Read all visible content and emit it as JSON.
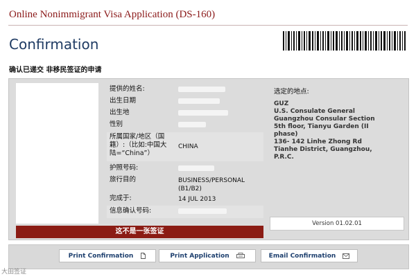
{
  "header": {
    "title": "Online Nonimmigrant Visa Application (DS-160)",
    "page_title": "Confirmation",
    "subtitle": "确认已递交  非移民签证的申请"
  },
  "applicant": {
    "surname_label": "提供的姓名:",
    "dob_label": "出生日期",
    "pob_label": "出生地",
    "gender_label": "性别",
    "nationality_label_line1": "所属国家/地区（国",
    "nationality_label_line2": "籍）:（比如:中国大",
    "nationality_label_line3": "陆=“China”）",
    "nationality_value": "CHINA",
    "passport_label": "护照号码:",
    "purpose_label": "旅行目的",
    "purpose_value_line1": "BUSINESS/PERSONAL",
    "purpose_value_line2": "(B1/B2)",
    "completed_label": "完成于:",
    "completed_value": "14 JUL 2013",
    "confirmation_label": "信息确认号码:"
  },
  "warning": "这不是一张签证",
  "location": {
    "label": "选定的地点:",
    "lines": [
      "GUZ",
      "U.S. Consulate General",
      "Guangzhou Consular Section",
      "5th floor, Tianyu Garden (II",
      "phase)",
      "136- 142 Linhe Zhong Rd",
      "Tianhe District, Guangzhou,",
      "P.R.C."
    ]
  },
  "version": "Version 01.02.01",
  "buttons": {
    "print_confirmation": "Print Confirmation",
    "print_application": "Print Application",
    "email_confirmation": "Email Confirmation"
  },
  "icons": {
    "print_confirmation": "document-icon",
    "print_application": "print-icon",
    "email_confirmation": "mail-icon"
  },
  "watermark": "大田签证",
  "colors": {
    "header_red": "#8b1a1a",
    "title_blue": "#1f3b63",
    "warning_bg": "#8b1c14",
    "button_text": "#1d3f6e"
  }
}
